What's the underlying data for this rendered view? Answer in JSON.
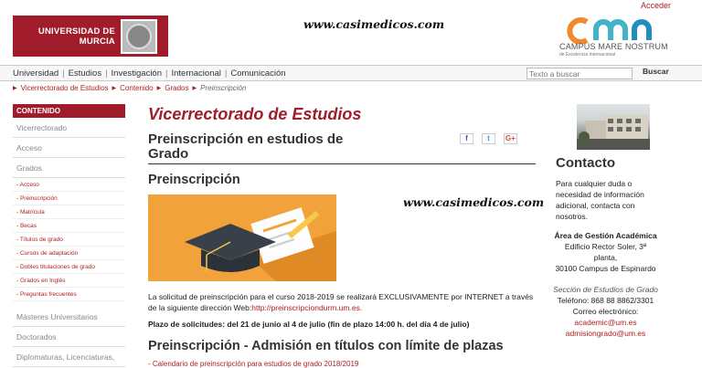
{
  "header": {
    "university_name": "UNIVERSIDAD DE MURCIA",
    "watermark": "www.casimedicos.com",
    "acceder": "Acceder",
    "campus_title": "CAMPUS MARE NOSTRUM",
    "campus_subtitle": "de Excelencia Internacional"
  },
  "nav": {
    "items": [
      "Universidad",
      "Estudios",
      "Investigación",
      "Internacional",
      "Comunicación"
    ],
    "search_placeholder": "Texto a buscar",
    "search_button": "Buscar"
  },
  "breadcrumb": [
    "Vicerrectorado de Estudios",
    "Contenido",
    "Grados",
    "Preinscripción"
  ],
  "sidebar": {
    "header": "CONTENIDO",
    "items_top": [
      "Vicerrectorado",
      "Acceso",
      "Grados"
    ],
    "sub_items": [
      "- Acceso",
      "- Preinscripción",
      "- Matrícula",
      "- Becas",
      "- Títulos de grado",
      "- Cursos de adaptación",
      "- Dobles titulaciones de grado",
      "- Grados en Inglés",
      "- Preguntas frecuentes"
    ],
    "items_bottom": [
      "Másteres Universitarios",
      "Doctorados",
      "Diplomaturas, Licenciaturas,"
    ]
  },
  "main": {
    "dept_title": "Vicerrectorado de Estudios",
    "page_title": "Preinscripción en estudios de Grado",
    "section_title": "Preinscripción",
    "social": [
      "f",
      "t",
      "G+"
    ],
    "paragraph_1_text": "La solicitud de preinscripción para el curso 2018-2019 se realizará EXCLUSIVAMENTE por INTERNET a través de la siguiente dirección Web:",
    "paragraph_1_link": "http://preinscripciondurm.um.es.",
    "paragraph_2": "Plazo de solicitudes: del 21 de junio al 4 de julio (fin de plazo 14:00 h. del día 4 de julio)",
    "section_2_title": "Preinscripción - Admisión en títulos con límite de plazas",
    "bullet_1": "- Calendario de preinscripción para estudios de grado 2018/2019"
  },
  "right": {
    "contact_title": "Contacto",
    "contact_intro": "Para cualquier duda o necesidad de información adicional, contacta con nosotros.",
    "office_name": "Área de Gestión Académica",
    "address_1": "Edificio Rector Soler, 3ª",
    "address_2": "planta,",
    "address_3": "30100 Campus de Espinardo",
    "section_name": "Sección de Estudios de Grado",
    "phone": "Teléfono: 868 88 8862/3301",
    "email_label": "Correo electrónico:",
    "email_1": "academic@um.es",
    "email_2": "admisiongrado@um.es"
  },
  "colors": {
    "brand_red": "#a01c2a",
    "link_red": "#b0201f",
    "banner_orange": "#f2a23a"
  }
}
